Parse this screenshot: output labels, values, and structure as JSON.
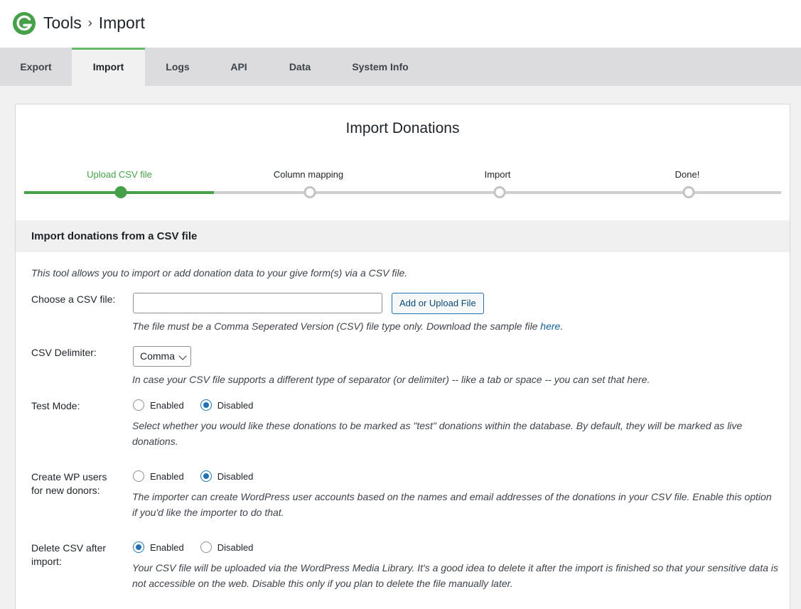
{
  "header": {
    "section": "Tools",
    "separator": "›",
    "page": "Import"
  },
  "tabs": [
    {
      "label": "Export"
    },
    {
      "label": "Import"
    },
    {
      "label": "Logs"
    },
    {
      "label": "API"
    },
    {
      "label": "Data"
    },
    {
      "label": "System Info"
    }
  ],
  "card": {
    "title": "Import Donations"
  },
  "steps": [
    {
      "label": "Upload CSV file"
    },
    {
      "label": "Column mapping"
    },
    {
      "label": "Import"
    },
    {
      "label": "Done!"
    }
  ],
  "section": {
    "title": "Import donations from a CSV file"
  },
  "intro": "This tool allows you to import or add donation data to your give form(s) via a CSV file.",
  "csv_file": {
    "label": "Choose a CSV file:",
    "value": "",
    "button": "Add or Upload File",
    "desc_prefix": "The file must be a Comma Seperated Version (CSV) file type only. Download the sample file ",
    "link": "here",
    "desc_suffix": "."
  },
  "delimiter": {
    "label": "CSV Delimiter:",
    "selected": "Comma",
    "desc": "In case your CSV file supports a different type of separator (or delimiter) -- like a tab or space -- you can set that here."
  },
  "test_mode": {
    "label": "Test Mode:",
    "enabled": "Enabled",
    "disabled": "Disabled",
    "value": "disabled",
    "desc": "Select whether you would like these donations to be marked as \"test\" donations within the database. By default, they will be marked as live donations."
  },
  "create_users": {
    "label_line1": "Create WP users",
    "label_line2": "for new donors:",
    "enabled": "Enabled",
    "disabled": "Disabled",
    "value": "disabled",
    "desc": "The importer can create WordPress user accounts based on the names and email addresses of the donations in your CSV file. Enable this option if you'd like the importer to do that."
  },
  "delete_csv": {
    "label_line1": "Delete CSV after",
    "label_line2": "import:",
    "enabled": "Enabled",
    "disabled": "Disabled",
    "value": "enabled",
    "desc": "Your CSV file will be uploaded via the WordPress Media Library. It's a good idea to delete it after the import is finished so that your sensitive data is not accessible on the web. Disable this only if you plan to delete the file manually later."
  },
  "colors": {
    "accent_green": "#46a049",
    "link_blue": "#2271b1"
  },
  "icons": {
    "logo": "givewp-logo-icon",
    "select": "chevron-down-icon"
  }
}
